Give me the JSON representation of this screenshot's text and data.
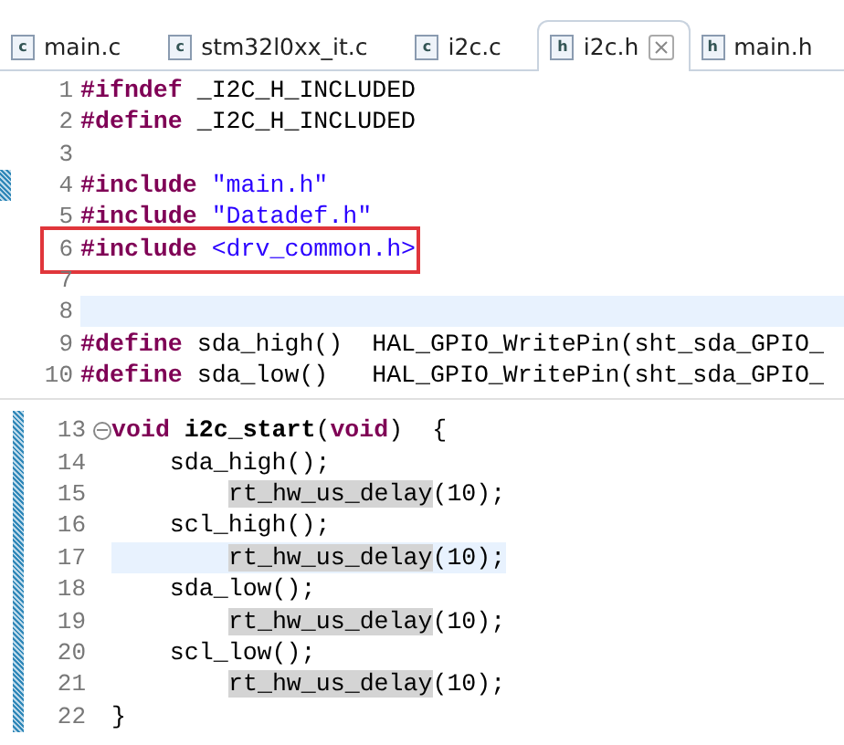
{
  "tabs": [
    {
      "label": "main.c",
      "file_type": "c",
      "selected": false
    },
    {
      "label": "stm32l0xx_it.c",
      "file_type": "c",
      "selected": false
    },
    {
      "label": "i2c.c",
      "file_type": "c",
      "selected": false
    },
    {
      "label": "i2c.h",
      "file_type": "h",
      "selected": true
    },
    {
      "label": "main.h",
      "file_type": "h",
      "selected": false
    }
  ],
  "top_editor": {
    "lines": [
      {
        "number": "1",
        "kind": "code",
        "tokens": [
          {
            "text": "#ifndef",
            "kind": "keyword"
          },
          {
            "text": " _I2C_H_INCLUDED",
            "kind": "plain"
          }
        ]
      },
      {
        "number": "2",
        "kind": "code",
        "tokens": [
          {
            "text": "#define",
            "kind": "keyword"
          },
          {
            "text": " _I2C_H_INCLUDED",
            "kind": "plain"
          }
        ]
      },
      {
        "number": "3",
        "kind": "code"
      },
      {
        "number": "4",
        "kind": "code",
        "changed": true,
        "tokens": [
          {
            "text": "#include",
            "kind": "keyword"
          },
          {
            "text": " \"main.h\"",
            "kind": "string"
          }
        ]
      },
      {
        "number": "5",
        "kind": "code",
        "tokens": [
          {
            "text": "#include",
            "kind": "keyword"
          },
          {
            "text": " \"Datadef.h\"",
            "kind": "string"
          }
        ]
      },
      {
        "number": "6",
        "kind": "code",
        "boxed": true,
        "tokens": [
          {
            "text": "#include",
            "kind": "keyword"
          },
          {
            "text": " <drv_common.h>",
            "kind": "string"
          }
        ]
      },
      {
        "number": "7",
        "kind": "code"
      },
      {
        "number": "8",
        "kind": "code",
        "current": true
      },
      {
        "number": "9",
        "kind": "code",
        "tokens": [
          {
            "text": "#define",
            "kind": "keyword"
          },
          {
            "text": " sda_high()  HAL_GPIO_WritePin(sht_sda_GPIO_",
            "kind": "plain"
          }
        ]
      },
      {
        "number": "10",
        "kind": "code",
        "tokens": [
          {
            "text": "#define",
            "kind": "keyword"
          },
          {
            "text": " sda_low()   HAL_GPIO_WritePin(sht_sda_GPIO_",
            "kind": "plain"
          }
        ]
      }
    ]
  },
  "bottom_editor": {
    "lines": [
      {
        "number": "13",
        "kind": "code",
        "foldable": true,
        "tokens": [
          {
            "text": "void",
            "kind": "keyword"
          },
          {
            "text": " i2c_start",
            "kind": "function"
          },
          {
            "text": "(",
            "kind": "plain"
          },
          {
            "text": "void",
            "kind": "keyword"
          },
          {
            "text": ")  {",
            "kind": "plain"
          }
        ]
      },
      {
        "number": "14",
        "kind": "code",
        "tokens": [
          {
            "text": "    sda_high();",
            "kind": "plain"
          }
        ]
      },
      {
        "number": "15",
        "kind": "nested",
        "tokens": [
          {
            "text": "rt_hw_us_delay",
            "kind": "occurrence"
          },
          {
            "text": "(10);",
            "kind": "plain"
          }
        ]
      },
      {
        "number": "16",
        "kind": "code",
        "tokens": [
          {
            "text": "    scl_high();",
            "kind": "plain"
          }
        ]
      },
      {
        "number": "17",
        "kind": "nested",
        "current": true,
        "tokens": [
          {
            "text": "rt_hw_us_delay",
            "kind": "occurrence"
          },
          {
            "text": "(10);",
            "kind": "plain"
          }
        ]
      },
      {
        "number": "18",
        "kind": "code",
        "tokens": [
          {
            "text": "    sda_low();",
            "kind": "plain"
          }
        ]
      },
      {
        "number": "19",
        "kind": "nested",
        "tokens": [
          {
            "text": "rt_hw_us_delay",
            "kind": "occurrence"
          },
          {
            "text": "(10);",
            "kind": "plain"
          }
        ]
      },
      {
        "number": "20",
        "kind": "code",
        "tokens": [
          {
            "text": "    scl_low();",
            "kind": "plain"
          }
        ]
      },
      {
        "number": "21",
        "kind": "nested",
        "tokens": [
          {
            "text": "rt_hw_us_delay",
            "kind": "occurrence"
          },
          {
            "text": "(10);",
            "kind": "plain"
          }
        ]
      },
      {
        "number": "22",
        "kind": "code",
        "tokens": [
          {
            "text": "}",
            "kind": "plain"
          }
        ]
      }
    ]
  }
}
